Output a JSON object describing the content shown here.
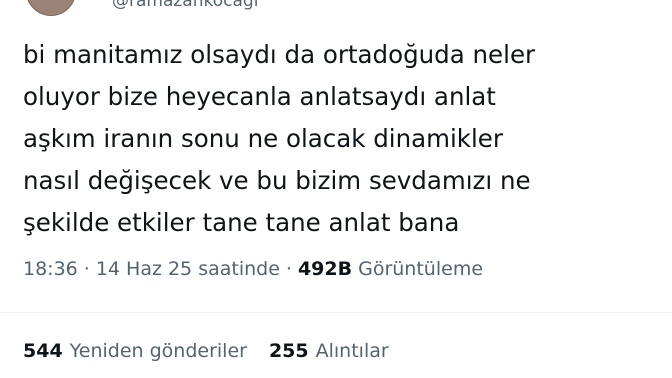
{
  "author": {
    "handle": "@ramazankocagi"
  },
  "tweet": {
    "lines": [
      "bi manitamız olsaydı da ortadoğuda neler",
      "oluyor bize heyecanla anlatsaydı anlat",
      "aşkım iranın sonu ne olacak dinamikler",
      "nasıl değişecek ve bu bizim sevdamızı ne",
      "şekilde etkiler tane tane anlat bana"
    ]
  },
  "meta": {
    "time": "18:36",
    "separator": "·",
    "date": "14 Haz 25 saatinde",
    "views_count": "492B",
    "views_label": "Görüntüleme"
  },
  "stats": {
    "retweets_count": "544",
    "retweets_label": "Yeniden gönderiler",
    "quotes_count": "255",
    "quotes_label": "Alıntılar"
  }
}
